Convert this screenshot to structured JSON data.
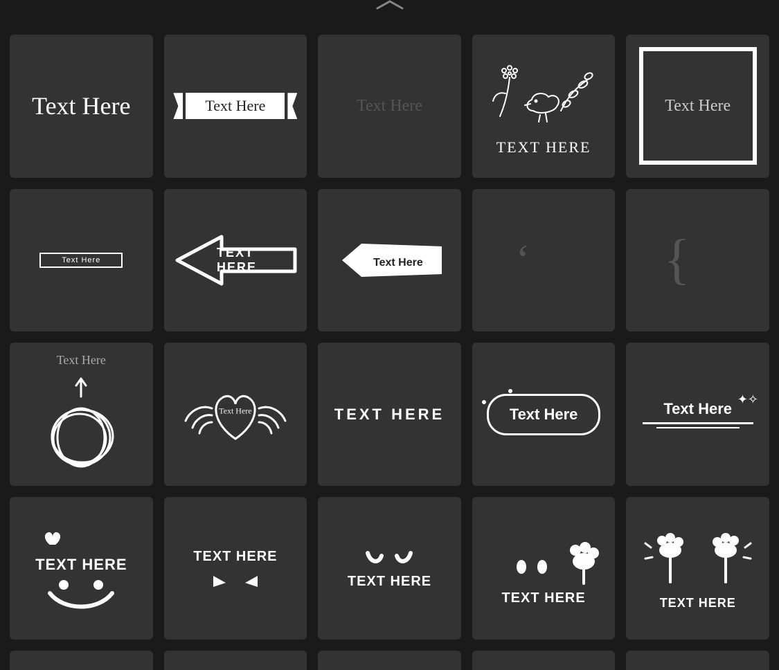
{
  "templates": [
    {
      "name": "serif-plain",
      "label": "Text Here",
      "case": "mixed"
    },
    {
      "name": "ribbon-banner",
      "label": "Text Here",
      "case": "mixed"
    },
    {
      "name": "ghost-serif",
      "label": "Text Here",
      "case": "mixed"
    },
    {
      "name": "bird-flowers",
      "label": "TEXT HERE",
      "case": "upper-script"
    },
    {
      "name": "square-frame",
      "label": "Text Here",
      "case": "mixed"
    },
    {
      "name": "thin-bar",
      "label": "Text Here",
      "case": "mixed"
    },
    {
      "name": "arrow-left",
      "label": "TEXT HERE",
      "case": "upper"
    },
    {
      "name": "tag-right",
      "label": "Text Here",
      "case": "mixed"
    },
    {
      "name": "quote-mark",
      "label": "‘",
      "case": "glyph"
    },
    {
      "name": "brace-mark",
      "label": "{",
      "case": "glyph"
    },
    {
      "name": "scribble-circle",
      "label": "Text Here",
      "case": "script"
    },
    {
      "name": "heart-wings",
      "label": "Text Here",
      "case": "script"
    },
    {
      "name": "chunky-caps",
      "label": "TEXT HERE",
      "case": "upper"
    },
    {
      "name": "pill-border",
      "label": "Text Here",
      "case": "mixed"
    },
    {
      "name": "underline-spark",
      "label": "Text Here",
      "case": "mixed"
    },
    {
      "name": "smiley",
      "label": "TEXT HERE",
      "case": "upper"
    },
    {
      "name": "eyes-below",
      "label": "TEXT HERE",
      "case": "upper"
    },
    {
      "name": "eyes-above",
      "label": "TEXT HERE",
      "case": "upper"
    },
    {
      "name": "paw-side",
      "label": "TEXT HERE",
      "case": "upper"
    },
    {
      "name": "fists",
      "label": "TEXT HERE",
      "case": "upper"
    }
  ],
  "ui": {
    "collapse_tooltip": "Collapse panel"
  }
}
